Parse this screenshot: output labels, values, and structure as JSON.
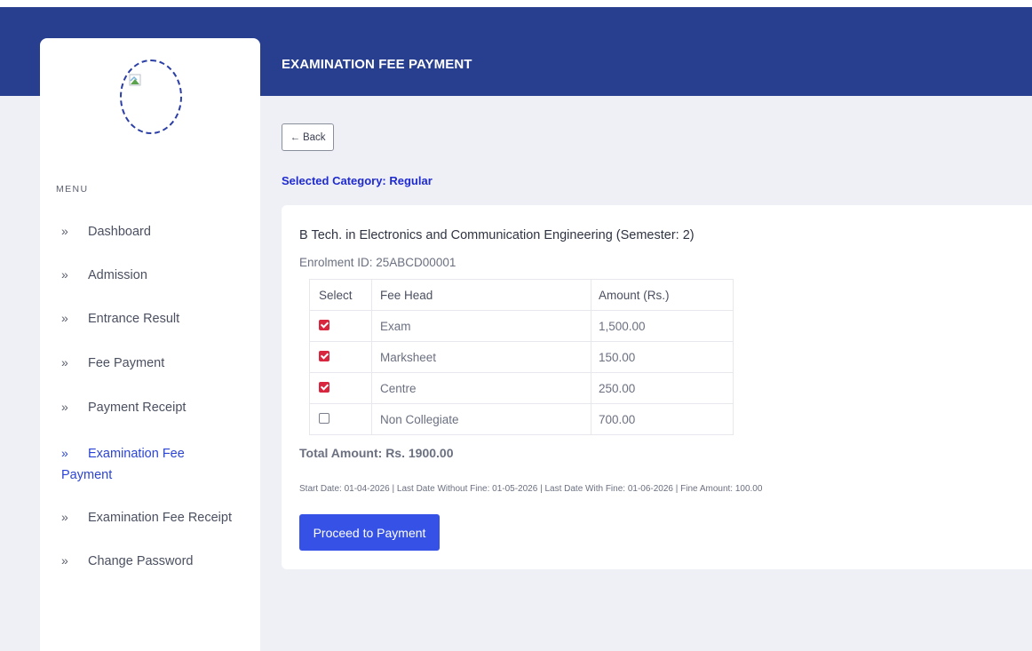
{
  "header": {
    "page_title": "EXAMINATION FEE PAYMENT"
  },
  "sidebar": {
    "logo_icon": "broken-image-icon",
    "menu_title": "MENU",
    "items": [
      {
        "label": "Dashboard"
      },
      {
        "label": "Admission"
      },
      {
        "label": "Entrance Result"
      },
      {
        "label": "Fee Payment"
      },
      {
        "label": "Payment Receipt"
      },
      {
        "label": "Examination Fee Payment",
        "active": true
      },
      {
        "label": "Examination Fee Receipt"
      },
      {
        "label": "Change Password"
      }
    ],
    "chevron": "»"
  },
  "main": {
    "back_label": "Back",
    "back_arrow": "←",
    "selected_category": "Selected Category: Regular",
    "course_title": "B Tech. in Electronics and Communication Engineering (Semester: 2)",
    "enrolment": "Enrolment ID: 25ABCD00001",
    "table": {
      "headers": [
        "Select",
        "Fee Head",
        "Amount (Rs.)"
      ],
      "rows": [
        {
          "checked": true,
          "fee_head": "Exam",
          "amount": "1,500.00"
        },
        {
          "checked": true,
          "fee_head": "Marksheet",
          "amount": "150.00"
        },
        {
          "checked": true,
          "fee_head": "Centre",
          "amount": "250.00"
        },
        {
          "checked": false,
          "fee_head": "Non Collegiate",
          "amount": "700.00"
        }
      ]
    },
    "total": "Total Amount: Rs. 1900.00",
    "dates": "Start Date: 01-04-2026 | Last Date Without Fine: 01-05-2026 | Last Date With Fine: 01-06-2026 | Fine Amount: 100.00",
    "proceed_label": "Proceed to Payment"
  },
  "colors": {
    "header_bg": "#283e8f",
    "accent": "#3551e6",
    "active_menu": "#2c44d6",
    "checkbox_checked": "#d7263d"
  }
}
